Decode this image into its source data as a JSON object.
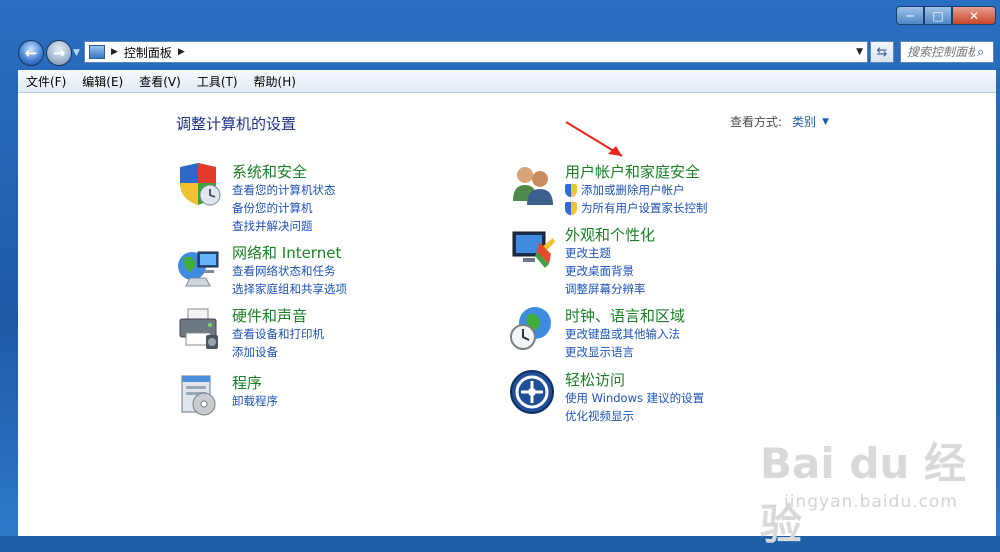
{
  "window": {
    "controls": {
      "minimize": "─",
      "maximize": "□",
      "close": "✕"
    }
  },
  "address": {
    "breadcrumb": "控制面板",
    "search_placeholder": "搜索控制面板"
  },
  "menu": [
    "文件(F)",
    "编辑(E)",
    "查看(V)",
    "工具(T)",
    "帮助(H)"
  ],
  "page": {
    "title": "调整计算机的设置",
    "view_label": "查看方式:",
    "view_value": "类别"
  },
  "categories": [
    {
      "title": "系统和安全",
      "icon": "shield-computer-icon",
      "links": [
        "查看您的计算机状态",
        "备份您的计算机",
        "查找并解决问题"
      ]
    },
    {
      "title": "网络和 Internet",
      "icon": "network-globe-icon",
      "links": [
        "查看网络状态和任务",
        "选择家庭组和共享选项"
      ]
    },
    {
      "title": "硬件和声音",
      "icon": "printer-icon",
      "links": [
        "查看设备和打印机",
        "添加设备"
      ]
    },
    {
      "title": "程序",
      "icon": "programs-icon",
      "links": [
        "卸载程序"
      ]
    },
    {
      "title": "用户帐户和家庭安全",
      "icon": "users-icon",
      "links": [
        "添加或删除用户帐户",
        "为所有用户设置家长控制"
      ]
    },
    {
      "title": "外观和个性化",
      "icon": "monitor-paint-icon",
      "links": [
        "更改主题",
        "更改桌面背景",
        "调整屏幕分辨率"
      ]
    },
    {
      "title": "时钟、语言和区域",
      "icon": "clock-globe-icon",
      "links": [
        "更改键盘或其他输入法",
        "更改显示语言"
      ]
    },
    {
      "title": "轻松访问",
      "icon": "accessibility-icon",
      "links": [
        "使用 Windows 建议的设置",
        "优化视频显示"
      ]
    }
  ],
  "watermark": {
    "brand": "Bai du 经验",
    "url": "jingyan.baidu.com"
  },
  "colors": {
    "category_title": "#1a7f25",
    "link": "#1e53b7",
    "page_title": "#1e3287",
    "annotation_arrow": "#e8241a"
  }
}
